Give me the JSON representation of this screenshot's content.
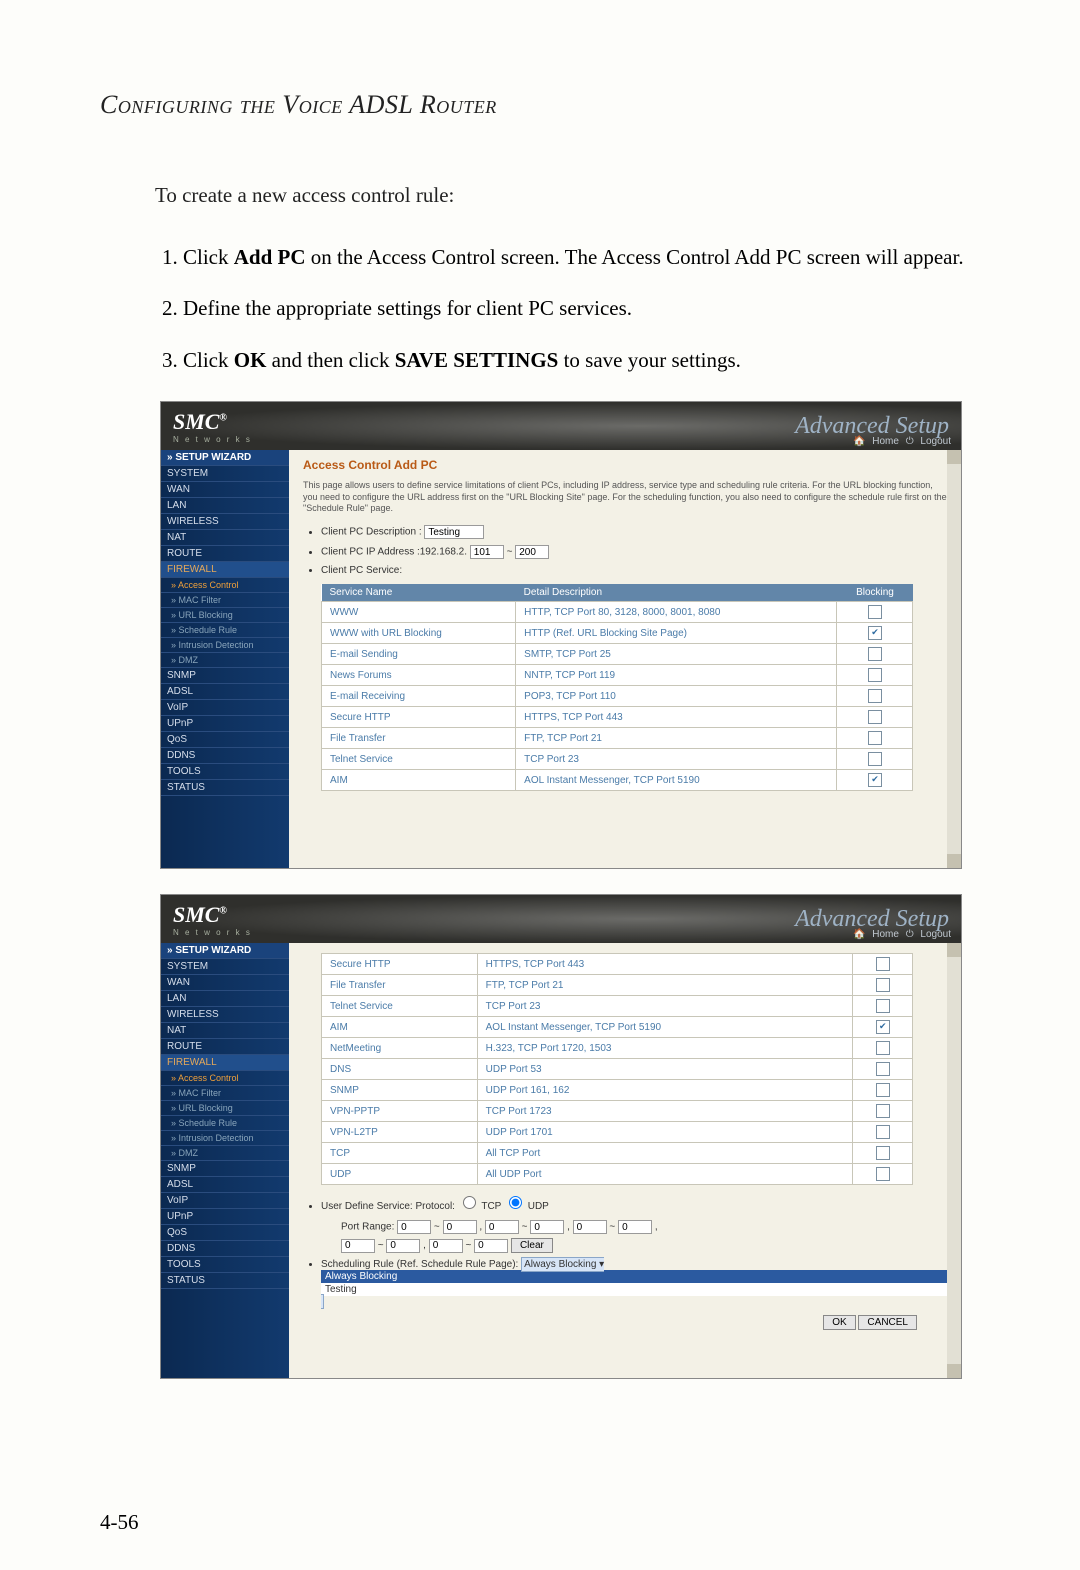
{
  "page_title": "Configuring the Voice ADSL Router",
  "intro": "To create a new access control rule:",
  "steps": {
    "s1a": "Click ",
    "s1b": "Add PC",
    "s1c": " on the Access Control screen. The Access Control Add PC screen will appear.",
    "s2": "Define the appropriate settings for client PC services.",
    "s3a": "Click ",
    "s3b": "OK",
    "s3c": " and then click ",
    "s3d": "SAVE SETTINGS",
    "s3e": " to save your settings."
  },
  "page_number": "4-56",
  "router": {
    "logo": "SMC",
    "logo_reg": "®",
    "logo_sub": "N e t w o r k s",
    "adv_title": "Advanced Setup",
    "home": "Home",
    "logout": "Logout",
    "side": {
      "setup": "» SETUP WIZARD",
      "system": "SYSTEM",
      "wan": "WAN",
      "lan": "LAN",
      "wireless": "WIRELESS",
      "nat": "NAT",
      "route": "ROUTE",
      "firewall": "FIREWALL",
      "access": "Access Control",
      "mac": "MAC Filter",
      "url": "URL Blocking",
      "sched": "Schedule Rule",
      "intr": "Intrusion Detection",
      "dmz": "DMZ",
      "snmp": "SNMP",
      "adsl": "ADSL",
      "voip": "VoIP",
      "upnp": "UPnP",
      "qos": "QoS",
      "ddns": "DDNS",
      "tools": "TOOLS",
      "status": "STATUS"
    },
    "main_title": "Access Control Add PC",
    "desc": "This page allows users to define service limitations of client PCs, including IP address, service type and scheduling rule criteria. For the URL blocking function, you need to configure the URL address first on the \"URL Blocking Site\" page. For the scheduling function, you also need to configure the schedule rule first on the \"Schedule Rule\" page.",
    "b1_label": "Client PC Description :",
    "b1_val": "Testing",
    "b2_label": "Client PC IP Address :192.168.2.",
    "b2_v1": "101",
    "b2_tilde": "~",
    "b2_v2": "200",
    "b3": "Client PC Service:",
    "th_service": "Service Name",
    "th_detail": "Detail Description",
    "th_block": "Blocking",
    "services1": [
      {
        "name": "WWW",
        "detail": "HTTP, TCP Port 80, 3128, 8000, 8001, 8080",
        "chk": false
      },
      {
        "name": "WWW with URL Blocking",
        "detail": "HTTP (Ref. URL Blocking Site Page)",
        "chk": true
      },
      {
        "name": "E-mail Sending",
        "detail": "SMTP, TCP Port 25",
        "chk": false
      },
      {
        "name": "News Forums",
        "detail": "NNTP, TCP Port 119",
        "chk": false
      },
      {
        "name": "E-mail Receiving",
        "detail": "POP3, TCP Port 110",
        "chk": false
      },
      {
        "name": "Secure HTTP",
        "detail": "HTTPS, TCP Port 443",
        "chk": false
      },
      {
        "name": "File Transfer",
        "detail": "FTP, TCP Port 21",
        "chk": false
      },
      {
        "name": "Telnet Service",
        "detail": "TCP Port 23",
        "chk": false
      },
      {
        "name": "AIM",
        "detail": "AOL Instant Messenger, TCP Port 5190",
        "chk": true
      }
    ],
    "services2": [
      {
        "name": "Secure HTTP",
        "detail": "HTTPS, TCP Port 443",
        "chk": false
      },
      {
        "name": "File Transfer",
        "detail": "FTP, TCP Port 21",
        "chk": false
      },
      {
        "name": "Telnet Service",
        "detail": "TCP Port 23",
        "chk": false
      },
      {
        "name": "AIM",
        "detail": "AOL Instant Messenger, TCP Port 5190",
        "chk": true
      },
      {
        "name": "NetMeeting",
        "detail": "H.323, TCP Port 1720, 1503",
        "chk": false
      },
      {
        "name": "DNS",
        "detail": "UDP Port 53",
        "chk": false
      },
      {
        "name": "SNMP",
        "detail": "UDP Port 161, 162",
        "chk": false
      },
      {
        "name": "VPN-PPTP",
        "detail": "TCP Port 1723",
        "chk": false
      },
      {
        "name": "VPN-L2TP",
        "detail": "UDP Port 1701",
        "chk": false
      },
      {
        "name": "TCP",
        "detail": "All TCP Port",
        "chk": false
      },
      {
        "name": "UDP",
        "detail": "All UDP Port",
        "chk": false
      }
    ],
    "uds_label": "User Define Service: Protocol:",
    "tcp": "TCP",
    "udp": "UDP",
    "portrange": "Port Range:",
    "zero": "0",
    "clear": "Clear",
    "sched_label": "Scheduling Rule (Ref. Schedule Rule Page):",
    "sched_sel": "Always Blocking",
    "sched_opt1": "Always Blocking",
    "sched_opt2": "Testing",
    "ok": "OK",
    "cancel": "CANCEL"
  }
}
